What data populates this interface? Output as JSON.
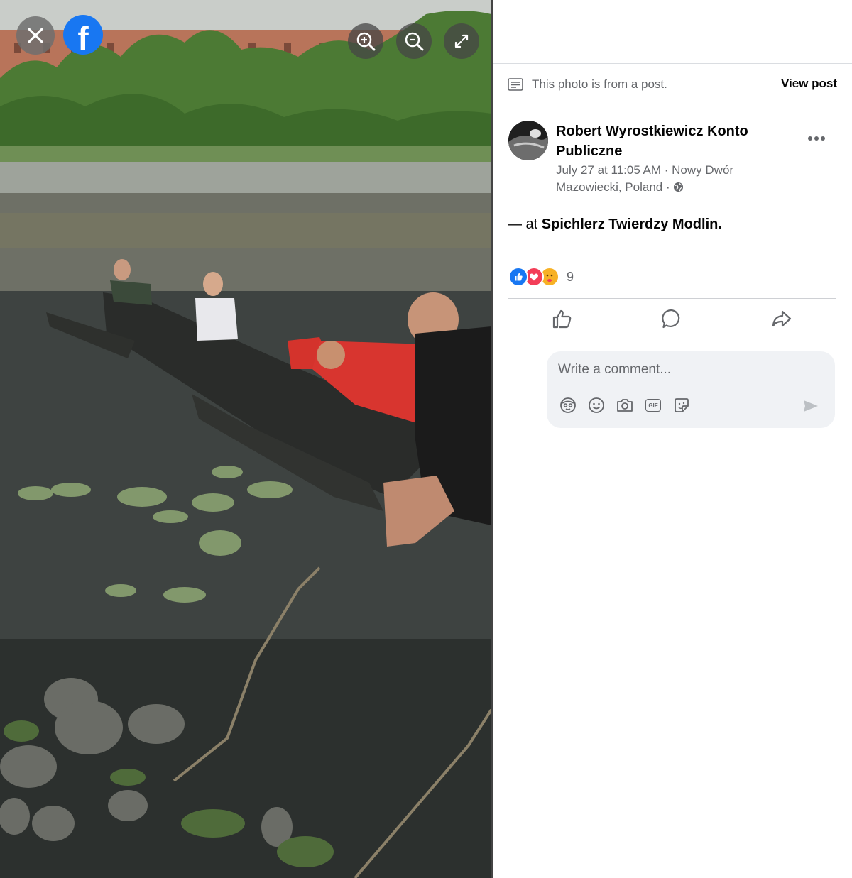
{
  "viewer": {
    "close_label": "Close",
    "logo_letter": "f",
    "zoom_in_label": "Zoom in",
    "zoom_out_label": "Zoom out",
    "fullscreen_label": "Enter fullscreen"
  },
  "sidebar": {
    "notice_text": "This photo is from a post.",
    "view_post_label": "View post",
    "author_name": "Robert Wyrostkiewicz Konto Publiczne",
    "post_meta": "July 27 at 11:05 AM · Nowy Dwór Mazowiecki, Poland ·",
    "post_text_prefix": "— at ",
    "post_place": "Spichlerz Twierdzy Modlin.",
    "reaction_count": "9",
    "reactions": [
      "like",
      "love",
      "care"
    ],
    "actions": [
      "like",
      "comment",
      "share"
    ],
    "comment_placeholder": "Write a comment...",
    "comment_tools": [
      "avatar-sticker",
      "emoji",
      "camera",
      "gif",
      "sticker"
    ],
    "gif_label": "GIF"
  },
  "colors": {
    "brand": "#1877f2",
    "love": "#f33e58",
    "care": "#f7b125",
    "secondary_text": "#65676b",
    "comment_bg": "#f0f2f5"
  }
}
